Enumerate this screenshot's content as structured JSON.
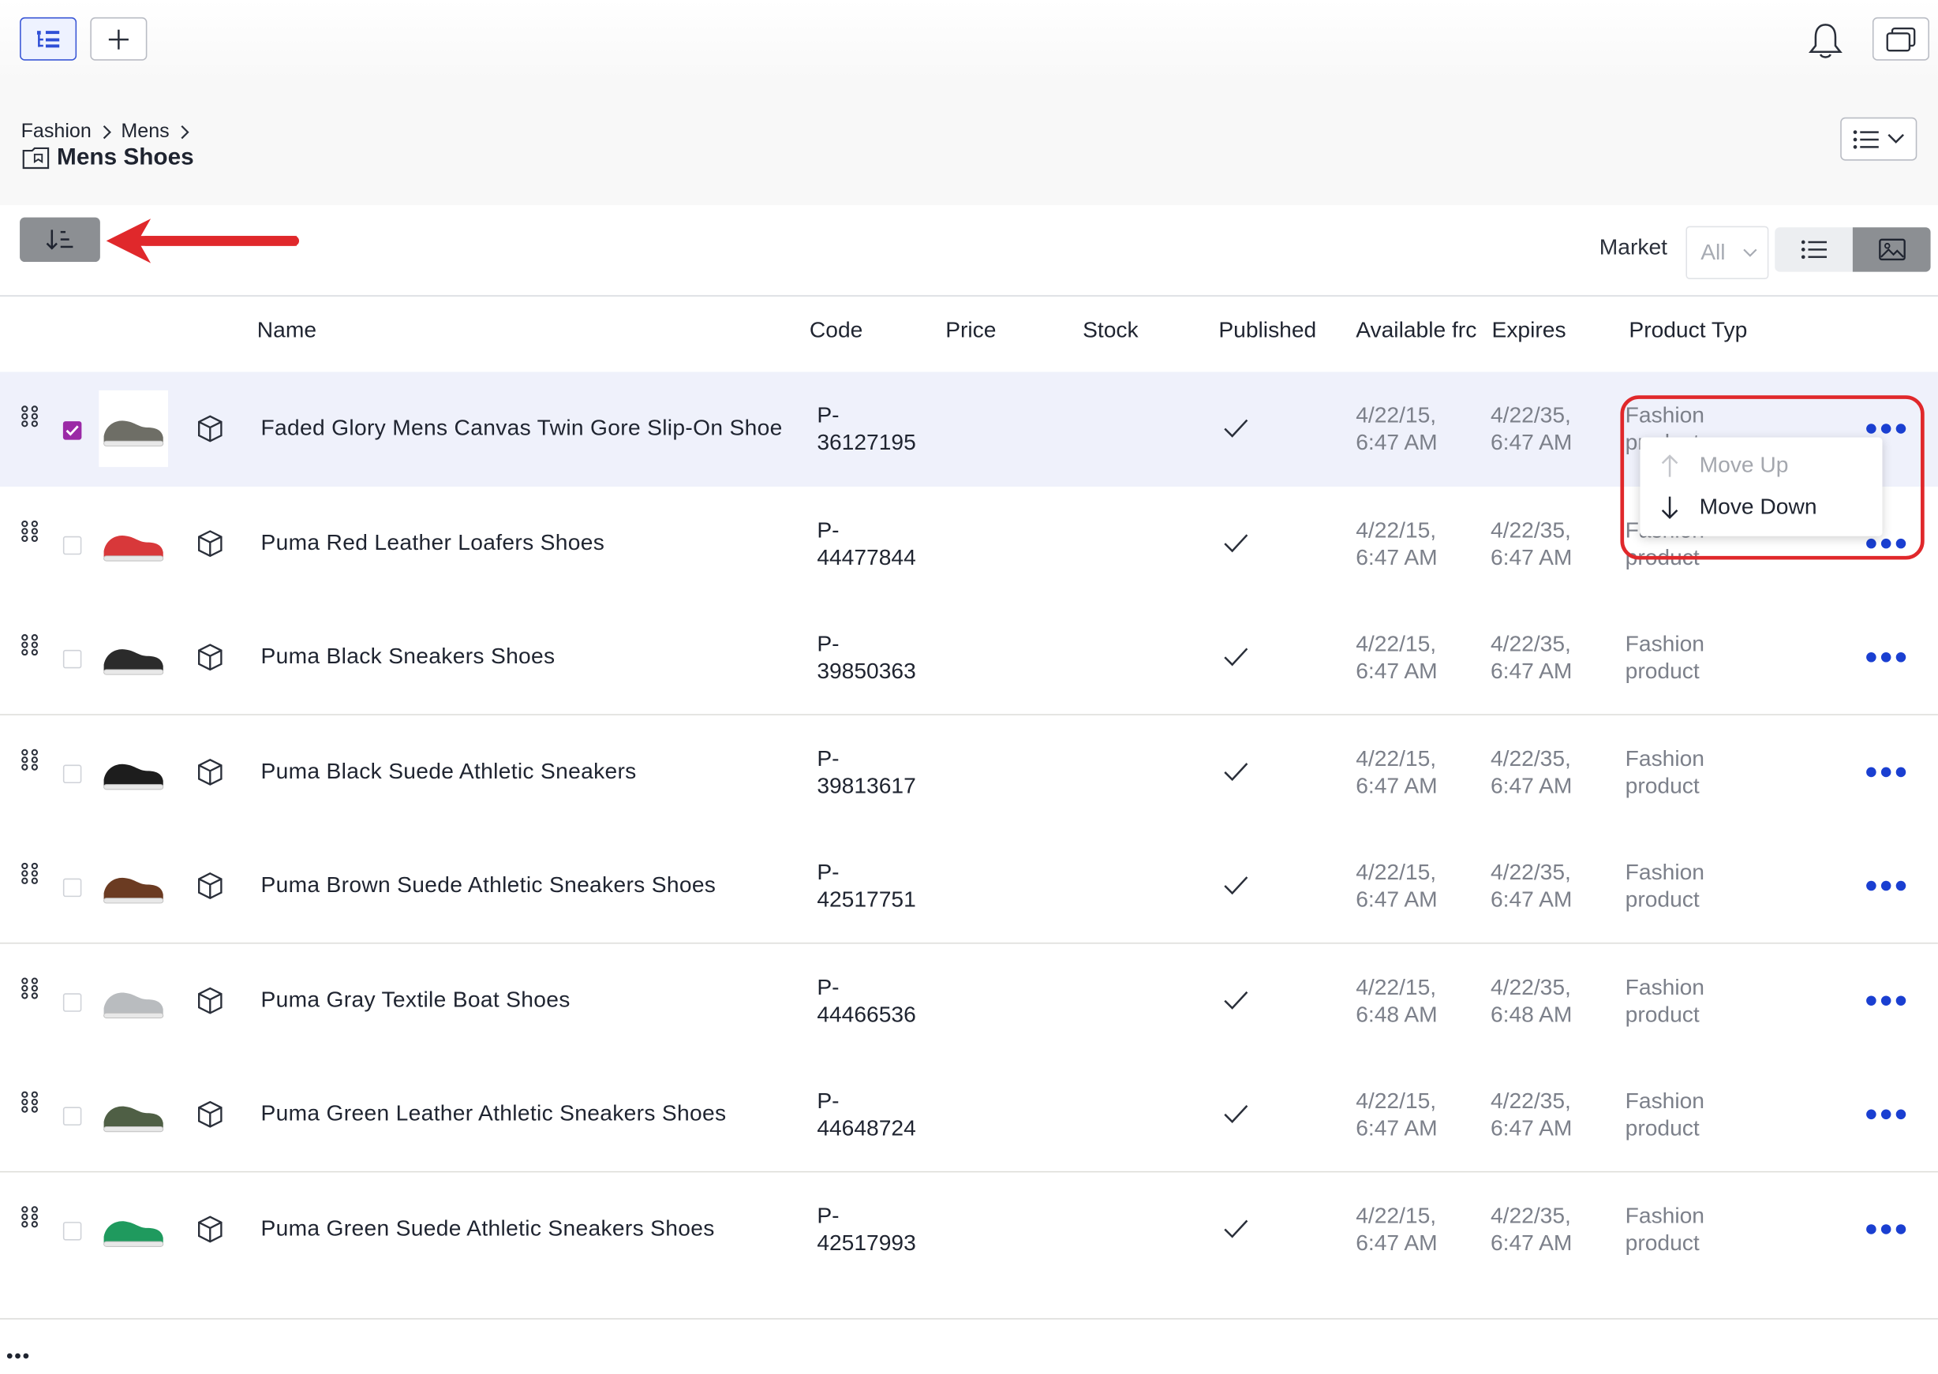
{
  "topbar": {
    "tree_button": "tree-view",
    "add_button": "+",
    "bell": "notifications",
    "folders": "folders"
  },
  "breadcrumb": {
    "items": [
      "Fashion",
      "Mens"
    ],
    "current": "Mens Shoes"
  },
  "toolbar": {
    "market_label": "Market",
    "market_value": "All"
  },
  "columns": [
    "Name",
    "Code",
    "Price",
    "Stock",
    "Published",
    "Available frc",
    "Expires",
    "Product Typ"
  ],
  "rows": [
    {
      "name": "Faded Glory Mens Canvas Twin Gore Slip-On Shoe",
      "code": "P-\n36127195",
      "available": "4/22/15,\n6:47 AM",
      "expires": "4/22/35,\n6:47 AM",
      "type": "Fashion\nproduct",
      "checked": true,
      "shoe": "#6e6e66"
    },
    {
      "name": "Puma Red Leather Loafers Shoes",
      "code": "P-\n44477844",
      "available": "4/22/15,\n6:47 AM",
      "expires": "4/22/35,\n6:47 AM",
      "type": "Fashion\nproduct",
      "checked": false,
      "shoe": "#d8383a"
    },
    {
      "name": "Puma Black Sneakers Shoes",
      "code": "P-\n39850363",
      "available": "4/22/15,\n6:47 AM",
      "expires": "4/22/35,\n6:47 AM",
      "type": "Fashion\nproduct",
      "checked": false,
      "shoe": "#2b2b2b"
    },
    {
      "name": "Puma Black Suede Athletic Sneakers",
      "code": "P-\n39813617",
      "available": "4/22/15,\n6:47 AM",
      "expires": "4/22/35,\n6:47 AM",
      "type": "Fashion\nproduct",
      "checked": false,
      "shoe": "#1d1d1d"
    },
    {
      "name": "Puma Brown Suede Athletic Sneakers Shoes",
      "code": "P-\n42517751",
      "available": "4/22/15,\n6:47 AM",
      "expires": "4/22/35,\n6:47 AM",
      "type": "Fashion\nproduct",
      "checked": false,
      "shoe": "#6b3b22"
    },
    {
      "name": "Puma Gray Textile Boat Shoes",
      "code": "P-\n44466536",
      "available": "4/22/15,\n6:48 AM",
      "expires": "4/22/35,\n6:48 AM",
      "type": "Fashion\nproduct",
      "checked": false,
      "shoe": "#b9bcbf"
    },
    {
      "name": "Puma Green Leather Athletic Sneakers Shoes",
      "code": "P-\n44648724",
      "available": "4/22/15,\n6:47 AM",
      "expires": "4/22/35,\n6:47 AM",
      "type": "Fashion\nproduct",
      "checked": false,
      "shoe": "#4f5f45"
    },
    {
      "name": "Puma Green Suede Athletic Sneakers Shoes",
      "code": "P-\n42517993",
      "available": "4/22/15,\n6:47 AM",
      "expires": "4/22/35,\n6:47 AM",
      "type": "Fashion\nproduct",
      "checked": false,
      "shoe": "#1f9a5e"
    }
  ],
  "context_menu": {
    "move_up": "Move Up",
    "move_down": "Move Down"
  },
  "footer": {
    "more": "•••"
  },
  "colors": {
    "accent": "#1a3fd1",
    "checkbox": "#9b2aa6",
    "highlight": "#e0282b"
  }
}
